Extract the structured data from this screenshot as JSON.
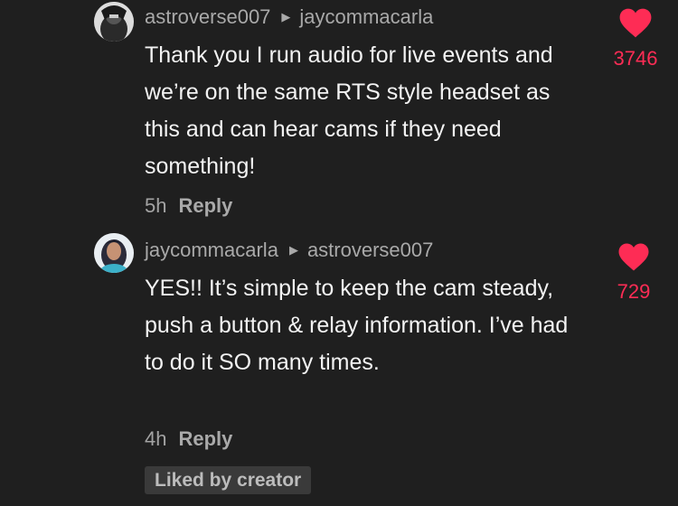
{
  "comments": [
    {
      "author": "astroverse007",
      "reply_to": "jaycommacarla",
      "text": "Thank you I run audio for live events and we’re on the same RTS style headset as this and can hear cams if they need something!",
      "time": "5h",
      "reply_label": "Reply",
      "likes": "3746",
      "liked": true
    },
    {
      "author": "jaycommacarla",
      "reply_to": "astroverse007",
      "text": "YES!! It’s simple to keep the cam steady, push a button & relay information. I’ve had to do it SO many times.",
      "time": "4h",
      "reply_label": "Reply",
      "likes": "729",
      "liked": false,
      "badge": "Liked by creator"
    }
  ],
  "colors": {
    "background": "#1f1f1f",
    "heart_liked": "#fe2c55",
    "heart_unliked": "#fe2c55",
    "badge_bg": "#3a3a3a"
  },
  "icons": {
    "reply_arrow": "caret-right-icon",
    "like": "heart-icon"
  }
}
